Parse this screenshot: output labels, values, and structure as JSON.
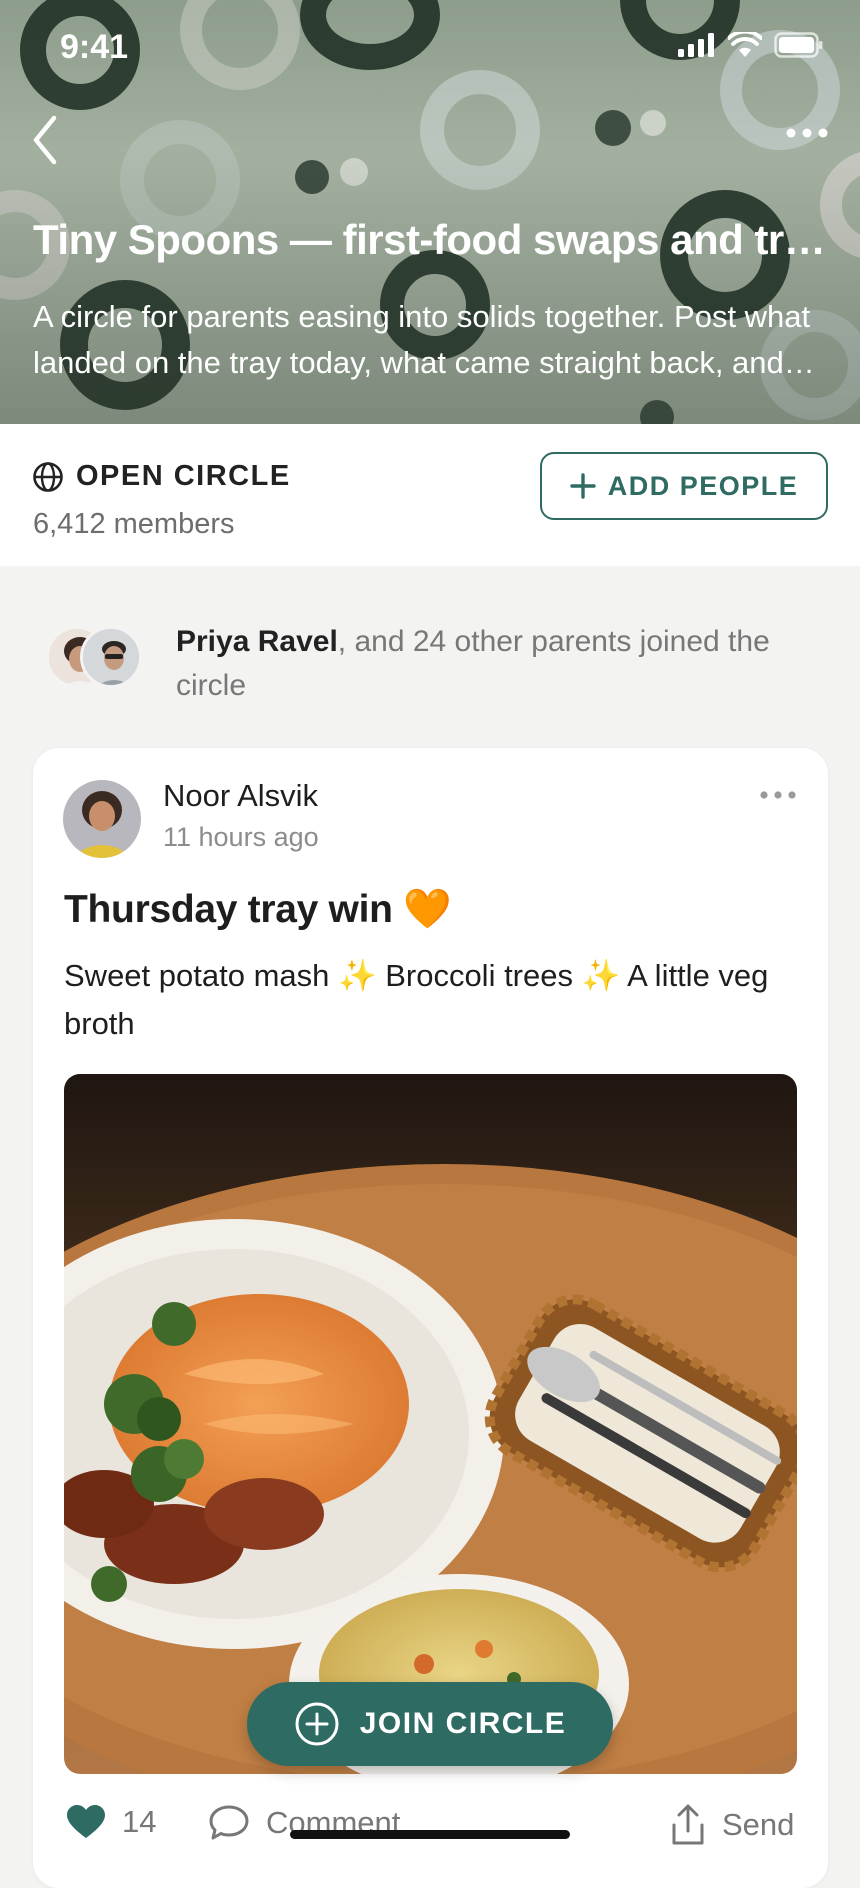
{
  "status_bar": {
    "time": "9:41"
  },
  "header": {
    "title": "Tiny Spoons — first-food swaps and tray wins",
    "description": "A circle for parents easing into solids together. Post what landed on the tray today, what came straight back, and what you'll try next."
  },
  "info": {
    "type_label": "OPEN CIRCLE",
    "members": "6,412 members",
    "add_people": "ADD PEOPLE"
  },
  "joined": {
    "name": "Priya Ravel",
    "rest": ", and 24 other parents joined the circle"
  },
  "post": {
    "author": "Noor Alsvik",
    "time_ago": "11 hours ago",
    "title": "Thursday tray win 🧡",
    "body": "Sweet potato mash ✨  Broccoli trees ✨  A little veg broth",
    "likes": "14",
    "comment_label": "Comment",
    "send_label": "Send"
  },
  "join_button": "JOIN CIRCLE",
  "colors": {
    "accent": "#2e6b63",
    "header_bg": "#9fad9c"
  }
}
